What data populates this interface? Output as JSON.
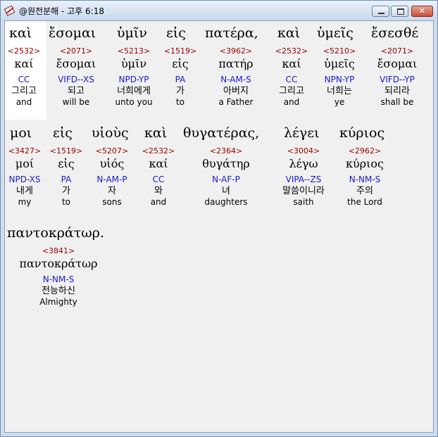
{
  "window": {
    "title": "@원전분해 - 고후 6:18",
    "controls": {
      "minimize": "",
      "maximize": "",
      "close": "✕"
    }
  },
  "lines": [
    {
      "surface": [
        "καὶ",
        "ἔσομαι",
        "ὑμῖν",
        "εἰς",
        "πατέρα,",
        "καὶ",
        "ὑμεῖς",
        "ἔσεσθέ"
      ],
      "units": [
        {
          "num": "<2532>",
          "lex": "καί",
          "morph": "CC",
          "kor": "그리고",
          "eng": "and"
        },
        {
          "num": "<2071>",
          "lex": "ἔσομαι",
          "morph": "VIFD--XS",
          "kor": "되고",
          "eng": "will be"
        },
        {
          "num": "<5213>",
          "lex": "ὑμῖν",
          "morph": "NPD-YP",
          "kor": "너희에게",
          "eng": "unto you"
        },
        {
          "num": "<1519>",
          "lex": "εἰς",
          "morph": "PA",
          "kor": "가",
          "eng": "to"
        },
        {
          "num": "<3962>",
          "lex": "πατήρ",
          "morph": "N-AM-S",
          "kor": "아버지",
          "eng": "a Father"
        },
        {
          "num": "<2532>",
          "lex": "καί",
          "morph": "CC",
          "kor": "그리고",
          "eng": "and"
        },
        {
          "num": "<5210>",
          "lex": "ὑμεῖς",
          "morph": "NPN-YP",
          "kor": "너희는",
          "eng": "ye"
        },
        {
          "num": "<2071>",
          "lex": "ἔσομαι",
          "morph": "VIFD--YP",
          "kor": "되리라",
          "eng": "shall be"
        }
      ]
    },
    {
      "surface": [
        "μοι",
        "εἰς",
        "υἱοὺς",
        "καὶ",
        "θυγατέρας,",
        "λέγει",
        "κύριος"
      ],
      "units": [
        {
          "num": "<3427>",
          "lex": "μοί",
          "morph": "NPD-XS",
          "kor": "내게",
          "eng": "my"
        },
        {
          "num": "<1519>",
          "lex": "εἰς",
          "morph": "PA",
          "kor": "가",
          "eng": "to"
        },
        {
          "num": "<5207>",
          "lex": "υἱός",
          "morph": "N-AM-P",
          "kor": "자",
          "eng": "sons"
        },
        {
          "num": "<2532>",
          "lex": "καί",
          "morph": "CC",
          "kor": "와",
          "eng": "and"
        },
        {
          "num": "<2364>",
          "lex": "θυγάτηρ",
          "morph": "N-AF-P",
          "kor": "녀",
          "eng": "daughters"
        },
        {
          "num": "<3004>",
          "lex": "λέγω",
          "morph": "VIPA--ZS",
          "kor": "말씀이니라",
          "eng": "saith"
        },
        {
          "num": "<2962>",
          "lex": "κύριος",
          "morph": "N-NM-S",
          "kor": "주의",
          "eng": "the Lord"
        }
      ]
    },
    {
      "surface": [
        "παντοκράτωρ."
      ],
      "units": [
        {
          "num": "<3841>",
          "lex": "παντοκράτωρ",
          "morph": "N-NM-S",
          "kor": "전능하신",
          "eng": "Almighty"
        }
      ]
    }
  ]
}
